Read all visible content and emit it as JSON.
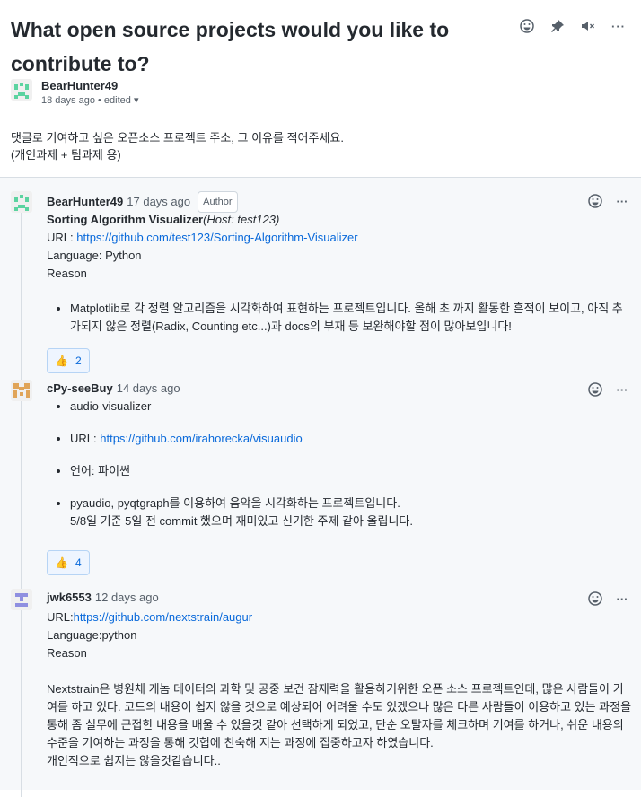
{
  "title": "What open source projects would you like to contribute to?",
  "op": {
    "author": "BearHunter49",
    "time": "18 days ago",
    "edited": "• edited",
    "body": [
      "댓글로 기여하고 싶은 오픈소스 프로젝트 주소, 그 이유를 적어주세요.",
      "(개인과제 + 팀과제 용)"
    ]
  },
  "comments": [
    {
      "author": "BearHunter49",
      "time": "17 days ago",
      "badge": "Author",
      "heading": "Sorting Algorithm Visualizer",
      "heading_note": "(Host: test123)",
      "url_label": "URL: ",
      "url": "https://github.com/test123/Sorting-Algorithm-Visualizer",
      "language": "Language: Python",
      "reason": "Reason",
      "bullet": "Matplotlib로 각 정렬 알고리즘을 시각화하여 표현하는 프로젝트입니다. 올해 초 까지 활동한 흔적이 보이고, 아직 추가되지 않은 정렬(Radix, Counting etc...)과 docs의 부재 등 보완해야할 점이 많아보입니다!",
      "reactions": "2"
    },
    {
      "author": "cPy-seeBuy",
      "time": "14 days ago",
      "bullets": [
        "audio-visualizer",
        "URL: ",
        "언어: 파이썬",
        "pyaudio, pyqtgraph를 이용하여 음악을 시각화하는 프로젝트입니다."
      ],
      "url": "https://github.com/irahorecka/visuaudio",
      "bullet4_line2": "5/8일 기준 5일 전 commit 했으며 재미있고 신기한 주제 같아 올립니다.",
      "reactions": "4"
    },
    {
      "author": "jwk6553",
      "time": "12 days ago",
      "url_label": "URL:",
      "url": "https://github.com/nextstrain/augur",
      "language": "Language:python",
      "reason": "Reason",
      "paragraph": "Nextstrain은 병원체 게놈 데이터의 과학 및 공중 보건 잠재력을 활용하기위한 오픈 소스 프로젝트인데, 많은 사람들이 기여를 하고 있다. 코드의 내용이 쉽지 않을 것으로 예상되어 어려울 수도 있겠으나 많은 다른 사람들이 이용하고 있는 과정을 통해 좀 실무에 근접한 내용을 배울 수 있을것 같아 선택하게 되었고, 단순 오탈자를 체크하며 기여를 하거나, 쉬운 내용의 수준을 기여하는 과정을 통해 깃헙에 친숙해 지는 과정에 집중하고자 하였습니다.",
      "last": "개인적으로 쉽지는 않을것같습니다.."
    }
  ]
}
